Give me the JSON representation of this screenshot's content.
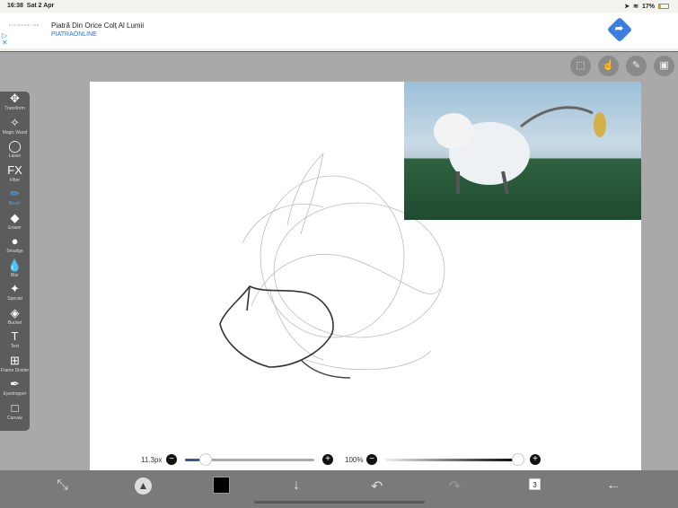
{
  "status": {
    "time": "16:38",
    "date": "Sat 2 Apr",
    "battery": "17%",
    "battery_level": 0.17
  },
  "ad": {
    "logo": "PIATRAONLINE",
    "title": "Piatră Din Orice Colț Al Lumii",
    "sponsor": "PIATRAONLINE"
  },
  "top_tools": [
    {
      "icon": "selection-icon",
      "g": "⬚"
    },
    {
      "icon": "hand-icon",
      "g": "☝"
    },
    {
      "icon": "pencil-icon",
      "g": "✎"
    },
    {
      "icon": "image-icon",
      "g": "▣"
    }
  ],
  "tools": [
    {
      "label": "Transform",
      "g": "✥"
    },
    {
      "label": "Magic Wand",
      "g": "✧"
    },
    {
      "label": "Lasso",
      "g": "◯"
    },
    {
      "label": "Filter",
      "g": "FX"
    },
    {
      "label": "Brush",
      "g": "✏",
      "active": true
    },
    {
      "label": "Eraser",
      "g": "◆"
    },
    {
      "label": "Smudge",
      "g": "●"
    },
    {
      "label": "Blur",
      "g": "💧"
    },
    {
      "label": "Special",
      "g": "✦"
    },
    {
      "label": "Bucket",
      "g": "◈"
    },
    {
      "label": "Text",
      "g": "T"
    },
    {
      "label": "Frame Divider",
      "g": "⊞"
    },
    {
      "label": "Eyedropper",
      "g": "✒"
    },
    {
      "label": "Canvas",
      "g": "□"
    }
  ],
  "brush": {
    "size": "11.3px",
    "size_fraction": 0.1,
    "opacity": "100%",
    "opacity_fraction": 1.0
  },
  "bottom": {
    "layers_count": "3",
    "color": "#000000"
  }
}
